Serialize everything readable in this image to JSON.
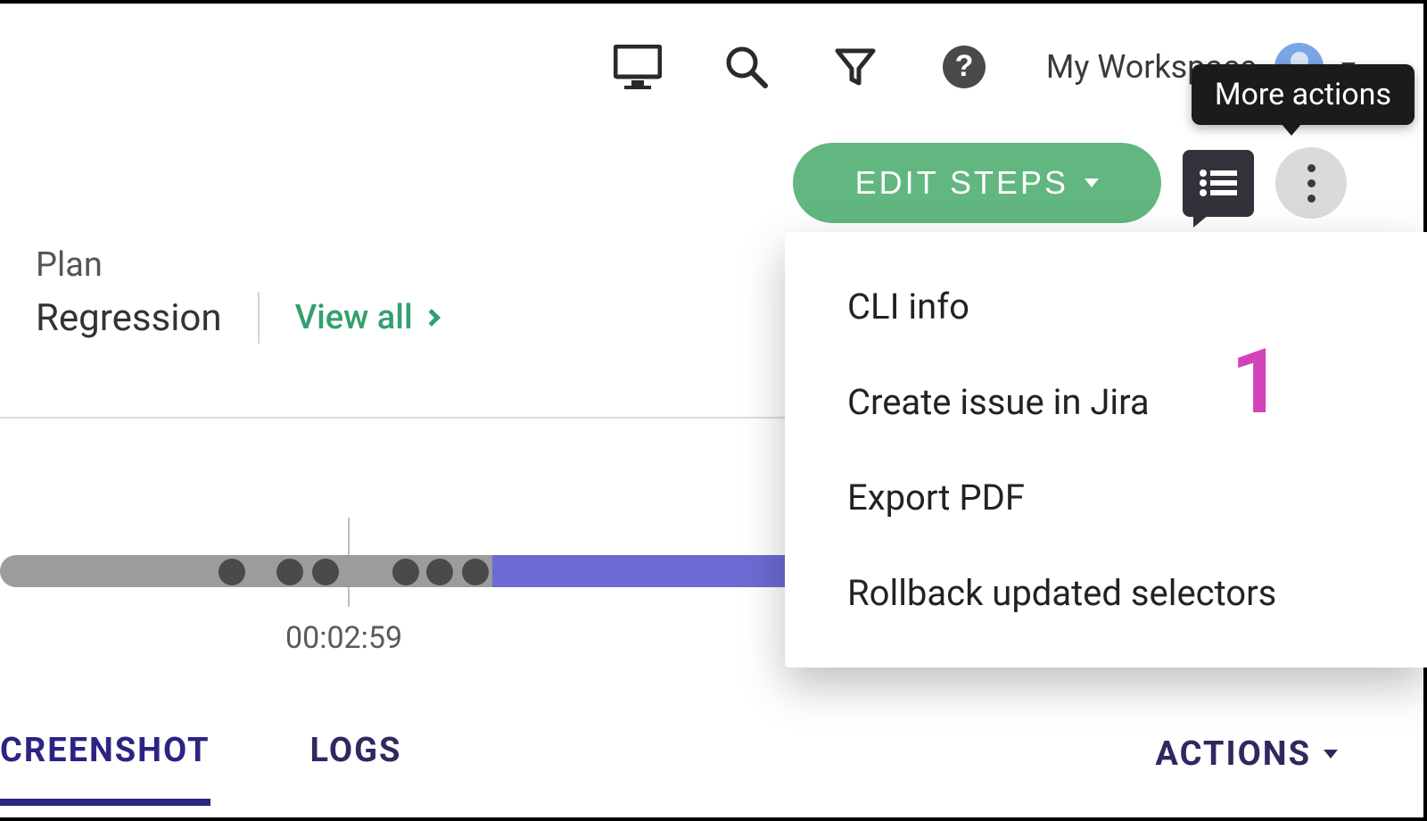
{
  "topbar": {
    "workspace_label": "My Workspace"
  },
  "tooltip": {
    "more_actions": "More actions"
  },
  "action_row": {
    "edit_steps_label": "EDIT STEPS"
  },
  "plan": {
    "label": "Plan",
    "name": "Regression",
    "view_all": "View all"
  },
  "timeline": {
    "time_label": "00:02:59"
  },
  "dropdown": {
    "items": [
      "CLI info",
      "Create issue in Jira",
      "Export PDF",
      "Rollback updated selectors"
    ]
  },
  "annotation": {
    "marker_1": "1"
  },
  "tabs": {
    "screenshot": "CREENSHOT",
    "logs": "LOGS",
    "actions": "ACTIONS"
  }
}
